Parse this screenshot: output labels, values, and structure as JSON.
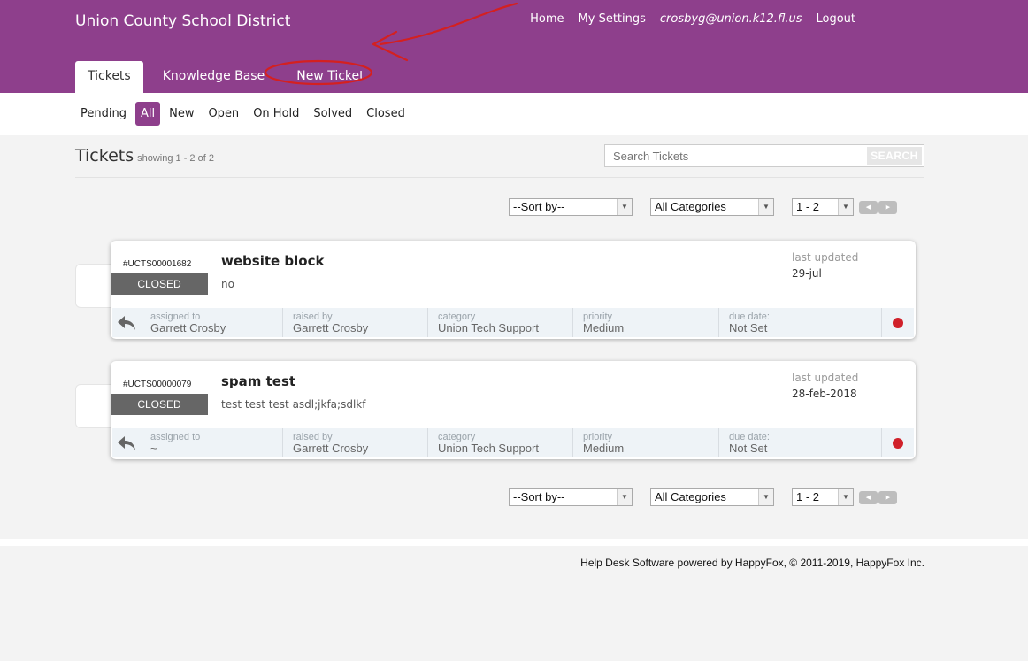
{
  "header": {
    "brand": "Union County School District",
    "nav": {
      "home": "Home",
      "settings": "My Settings",
      "email": "crosbyg@union.k12.fl.us",
      "logout": "Logout"
    },
    "tabs": [
      {
        "label": "Tickets",
        "active": true
      },
      {
        "label": "Knowledge Base",
        "active": false
      },
      {
        "label": "New Ticket",
        "active": false
      }
    ]
  },
  "filters": [
    {
      "label": "Pending",
      "active": false
    },
    {
      "label": "All",
      "active": true
    },
    {
      "label": "New",
      "active": false
    },
    {
      "label": "Open",
      "active": false
    },
    {
      "label": "On Hold",
      "active": false
    },
    {
      "label": "Solved",
      "active": false
    },
    {
      "label": "Closed",
      "active": false
    }
  ],
  "page": {
    "title": "Tickets",
    "showing": "showing 1 - 2 of 2",
    "search_placeholder": "Search Tickets",
    "search_button": "SEARCH"
  },
  "controls": {
    "sort": "--Sort by--",
    "category": "All Categories",
    "page": "1 - 2",
    "prev_icon": "left-triangle",
    "next_icon": "right-triangle"
  },
  "meta_labels": {
    "assigned": "assigned to",
    "raised": "raised by",
    "category": "category",
    "priority": "priority",
    "due": "due date:"
  },
  "tickets": [
    {
      "id": "#UCTS00001682",
      "status": "CLOSED",
      "subject": "website block",
      "description": "no",
      "updated_label": "last updated",
      "updated": "29-jul",
      "assigned": "Garrett Crosby",
      "raised": "Garrett Crosby",
      "category": "Union Tech Support",
      "priority": "Medium",
      "due": "Not Set",
      "indicator_color": "#d0212a"
    },
    {
      "id": "#UCTS00000079",
      "status": "CLOSED",
      "subject": "spam test",
      "description": "test test test asdl;jkfa;sdlkf",
      "updated_label": "last updated",
      "updated": "28-feb-2018",
      "assigned": "~",
      "raised": "Garrett Crosby",
      "category": "Union Tech Support",
      "priority": "Medium",
      "due": "Not Set",
      "indicator_color": "#d0212a"
    }
  ],
  "footer": "Help Desk Software powered by HappyFox, © 2011-2019, HappyFox Inc.",
  "colors": {
    "brand": "#8e3f8c",
    "status_closed": "#666666",
    "indicator": "#d0212a"
  }
}
